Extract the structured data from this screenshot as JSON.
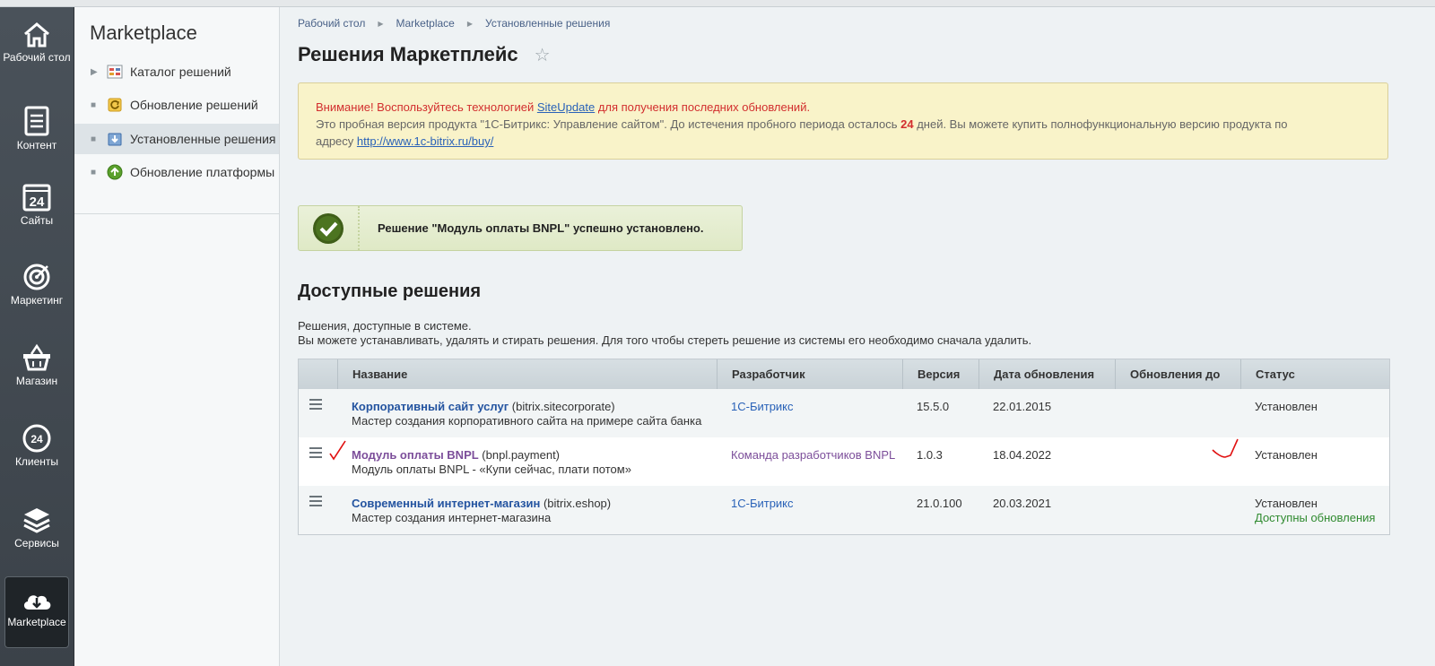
{
  "leftnav": {
    "items": [
      {
        "label": "Рабочий стол",
        "icon": "home-icon"
      },
      {
        "label": "Контент",
        "icon": "document-icon"
      },
      {
        "label": "Сайты",
        "icon": "calendar-24-icon"
      },
      {
        "label": "Маркетинг",
        "icon": "target-icon"
      },
      {
        "label": "Магазин",
        "icon": "basket-icon"
      },
      {
        "label": "Клиенты",
        "icon": "clients-24-icon"
      },
      {
        "label": "Сервисы",
        "icon": "layers-icon"
      },
      {
        "label": "Marketplace",
        "icon": "cloud-download-icon"
      }
    ]
  },
  "subnav": {
    "title": "Marketplace",
    "items": [
      {
        "label": "Каталог решений",
        "icon": "catalog-icon"
      },
      {
        "label": "Обновление решений",
        "icon": "update-solutions-icon"
      },
      {
        "label": "Установленные решения",
        "icon": "installed-icon"
      },
      {
        "label": "Обновление платформы",
        "icon": "platform-update-icon"
      }
    ]
  },
  "breadcrumb": [
    "Рабочий стол",
    "Marketplace",
    "Установленные решения"
  ],
  "page": {
    "title": "Решения Маркетплейс"
  },
  "warning": {
    "part1": "Внимание! Воспользуйтесь технологией ",
    "link": "SiteUpdate",
    "part2": " для получения последних обновлений.",
    "line2a": "Это пробная версия продукта \"1С-Битрикс: Управление сайтом\". До истечения пробного периода осталось ",
    "days": "24",
    "line2b": " дней. Вы можете купить полнофункциональную версию продукта по",
    "line3": "адресу ",
    "url": "http://www.1c-bitrix.ru/buy/"
  },
  "success": {
    "message": "Решение \"Модуль оплаты BNPL\" успешно установлено."
  },
  "section": {
    "title": "Доступные решения",
    "desc1": "Решения, доступные в системе.",
    "desc2": "Вы можете устанавливать, удалять и стирать решения. Для того чтобы стереть решение из системы его необходимо сначала удалить."
  },
  "table": {
    "headers": [
      "Название",
      "Разработчик",
      "Версия",
      "Дата обновления",
      "Обновления до",
      "Статус"
    ],
    "rows": [
      {
        "name": "Корпоративный сайт услуг",
        "code": " (bitrix.sitecorporate)",
        "desc": "Мастер создания корпоративного сайта на примере сайта банка",
        "developer": "1С-Битрикс",
        "version": "15.5.0",
        "date": "22.01.2015",
        "updates_until": "",
        "status": "Установлен",
        "status_extra": ""
      },
      {
        "name": "Модуль оплаты BNPL",
        "code": " (bnpl.payment)",
        "desc": "Модуль оплаты BNPL - «Купи сейчас, плати потом»",
        "developer": "Команда разработчиков BNPL",
        "version": "1.0.3",
        "date": "18.04.2022",
        "updates_until": "",
        "status": "Установлен",
        "status_extra": ""
      },
      {
        "name": "Современный интернет-магазин",
        "code": " (bitrix.eshop)",
        "desc": "Мастер создания интернет-магазина",
        "developer": "1С-Битрикс",
        "version": "21.0.100",
        "date": "20.03.2021",
        "updates_until": "",
        "status": "Установлен",
        "status_extra": "Доступны обновления"
      }
    ]
  },
  "colors": {
    "accent_link": "#2454a0",
    "warning_red": "#d22e2e",
    "success_green": "#2f8a2f",
    "annotation_red": "#e01010"
  }
}
